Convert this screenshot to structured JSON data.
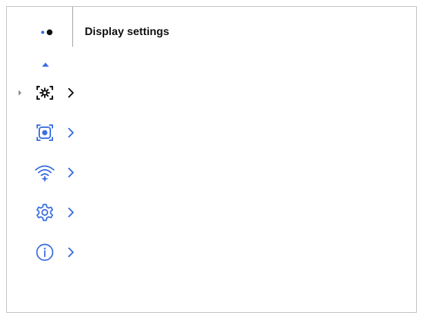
{
  "header": {
    "title": "Display settings"
  },
  "colors": {
    "accent": "#3b6fe0",
    "dark": "#111111"
  },
  "menu": {
    "items": [
      {
        "icon": "display-settings-gear-icon",
        "selected": true
      },
      {
        "icon": "capture-focus-icon",
        "selected": false
      },
      {
        "icon": "wifi-settings-icon",
        "selected": false
      },
      {
        "icon": "gear-icon",
        "selected": false
      },
      {
        "icon": "info-icon",
        "selected": false
      }
    ]
  }
}
